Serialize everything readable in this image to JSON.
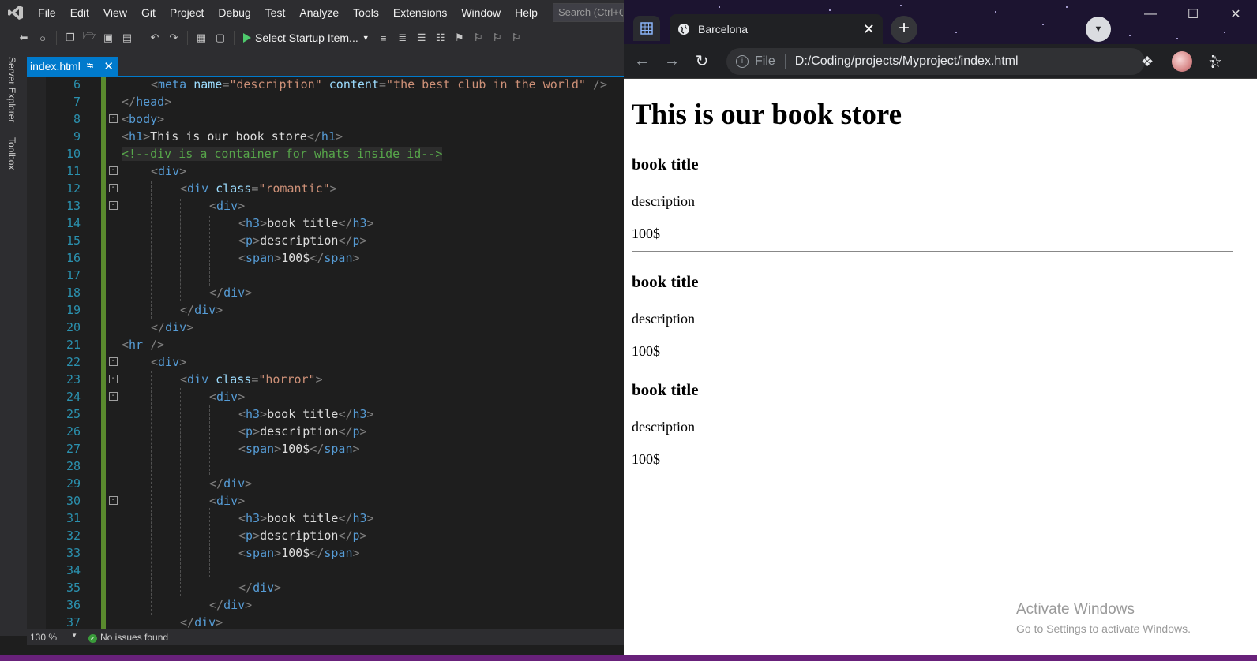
{
  "vs": {
    "menu": [
      "File",
      "Edit",
      "View",
      "Git",
      "Project",
      "Debug",
      "Test",
      "Analyze",
      "Tools",
      "Extensions",
      "Window",
      "Help"
    ],
    "search_placeholder": "Search (Ctrl+Q)",
    "startup_label": "Select Startup Item...",
    "side_tabs": [
      "Server Explorer",
      "Toolbox"
    ],
    "tab_title": "index.html",
    "zoom": "130 %",
    "status": "No issues found",
    "code": {
      "l6": "6",
      "l7": "7",
      "l8": "8",
      "l9": "9",
      "l10": "10",
      "l11": "11",
      "l12": "12",
      "l13": "13",
      "l14": "14",
      "l15": "15",
      "l16": "16",
      "l17": "17",
      "l18": "18",
      "l19": "19",
      "l20": "20",
      "l21": "21",
      "l22": "22",
      "l23": "23",
      "l24": "24",
      "l25": "25",
      "l26": "26",
      "l27": "27",
      "l28": "28",
      "l29": "29",
      "l30": "30",
      "l31": "31",
      "l32": "32",
      "l33": "33",
      "l34": "34",
      "l35": "35",
      "l36": "36",
      "l37": "37",
      "meta_attr_name": "name",
      "meta_name_val": "\"description\"",
      "meta_attr_content": "content",
      "meta_content_val": "\"the best club in the world\"",
      "h1_text": "This is our book store",
      "comment": "<!--div is a container for whats inside id-->",
      "class_attr": "class",
      "class_romantic": "\"romantic\"",
      "class_horror": "\"horror\"",
      "book_title": "book title",
      "description": "description",
      "price": "100$"
    }
  },
  "chrome": {
    "tab_title": "Barcelona",
    "url_scheme": "File",
    "url": "D:/Coding/projects/Myproject/index.html",
    "page": {
      "h1": "This is our book store",
      "books": [
        {
          "title": "book title",
          "description": "description",
          "price": "100$"
        },
        {
          "title": "book title",
          "description": "description",
          "price": "100$"
        },
        {
          "title": "book title",
          "description": "description",
          "price": "100$"
        }
      ]
    },
    "watermark_line1": "Activate Windows",
    "watermark_line2": "Go to Settings to activate Windows."
  }
}
